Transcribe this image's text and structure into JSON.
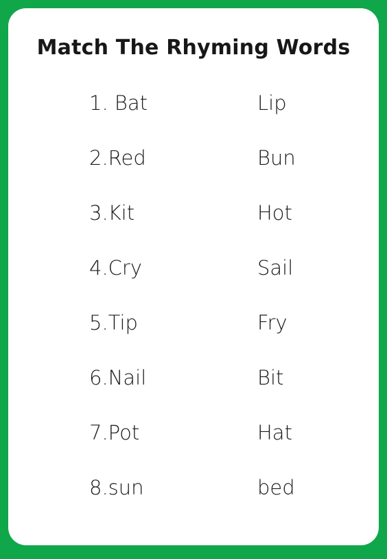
{
  "colors": {
    "frame_green": "#10A74B",
    "card_background": "#FFFFFF",
    "text": "#1A1A1A"
  },
  "worksheet": {
    "title": "Match The Rhyming Words",
    "rows": [
      {
        "left": "1. Bat",
        "right": "Lip"
      },
      {
        "left": "2.Red",
        "right": "Bun"
      },
      {
        "left": "3.Kit",
        "right": "Hot"
      },
      {
        "left": "4.Cry",
        "right": "Sail"
      },
      {
        "left": "5.Tip",
        "right": "Fry"
      },
      {
        "left": "6.Nail",
        "right": "Bit"
      },
      {
        "left": "7.Pot",
        "right": "Hat"
      },
      {
        "left": "8.sun",
        "right": "bed"
      }
    ]
  }
}
